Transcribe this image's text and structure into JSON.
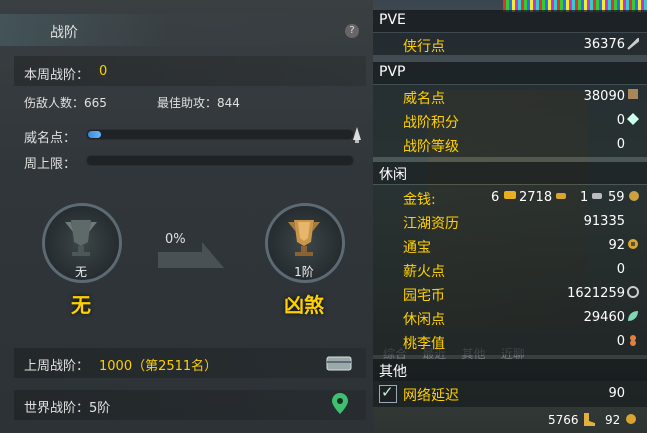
{
  "left": {
    "title": "战阶",
    "help_label": "?",
    "weekly_label": "本周战阶：",
    "weekly_value": "0",
    "kills_label": "伤敌人数：665",
    "assist_label": "最佳助攻：844",
    "prestige_label": "威名点：",
    "prestige_progress": 0.05,
    "weekly_cap_label": "周上限：",
    "weekly_cap_progress": 0,
    "current_rank_small": "无",
    "current_rank_big": "无",
    "progress_pct": "0%",
    "next_rank_small": "1阶",
    "next_rank_big": "凶煞",
    "last_week_label": "上周战阶：",
    "last_week_value": "1000（第2511名）",
    "world_label": "世界战阶：5阶"
  },
  "right": {
    "pve_title": "PVE",
    "pve_items": [
      {
        "label": "侠行点",
        "value": "36376"
      }
    ],
    "pvp_title": "PVP",
    "pvp_items": [
      {
        "label": "威名点",
        "value": "38090"
      },
      {
        "label": "战阶积分",
        "value": "0"
      },
      {
        "label": "战阶等级",
        "value": "0"
      }
    ],
    "leisure_title": "休闲",
    "money_label": "金钱:",
    "money_gold": "6",
    "money_silver": "2718",
    "money_copper1": "1",
    "money_copper2": "59",
    "leisure_items": [
      {
        "label": "江湖资历",
        "value": "91335"
      },
      {
        "label": "通宝",
        "value": "92"
      },
      {
        "label": "薪火点",
        "value": "0"
      },
      {
        "label": "园宅币",
        "value": "1621259"
      },
      {
        "label": "休闲点",
        "value": "29460"
      },
      {
        "label": "桃李值",
        "value": "0"
      }
    ],
    "other_title": "其他",
    "network_label": "网络延迟",
    "network_value": "90",
    "footer_value1": "5766",
    "footer_value2": "92"
  },
  "colors": {
    "accent_yellow": "#ffd000",
    "progress_blue": "#4fa3f0"
  }
}
